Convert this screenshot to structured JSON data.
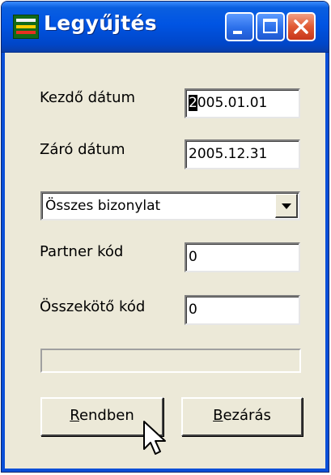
{
  "window": {
    "title": "Legyűjtés"
  },
  "form": {
    "start_date_label": "Kezdő dátum",
    "start_date_value_first": "2",
    "start_date_value_rest": "005.01.01",
    "end_date_label": "Záró dátum",
    "end_date_value": "2005.12.31",
    "document_type_selected": "Összes bizonylat",
    "partner_code_label": "Partner kód",
    "partner_code_value": "0",
    "connector_code_label": "Összekötő kód",
    "connector_code_value": "0",
    "progress_fraction": 0
  },
  "buttons": {
    "ok_underlined": "R",
    "ok_rest": "endben",
    "close_underlined": "B",
    "close_rest": "ezárás"
  },
  "icons": {
    "app": "app-icon",
    "minimize": "minimize-icon",
    "maximize": "maximize-icon",
    "close": "close-icon",
    "dropdown": "chevron-down-icon",
    "cursor": "mouse-pointer-icon"
  },
  "colors": {
    "titlebar": "#0054e3",
    "window_bg": "#ece9d8",
    "close_button": "#e05a33"
  }
}
